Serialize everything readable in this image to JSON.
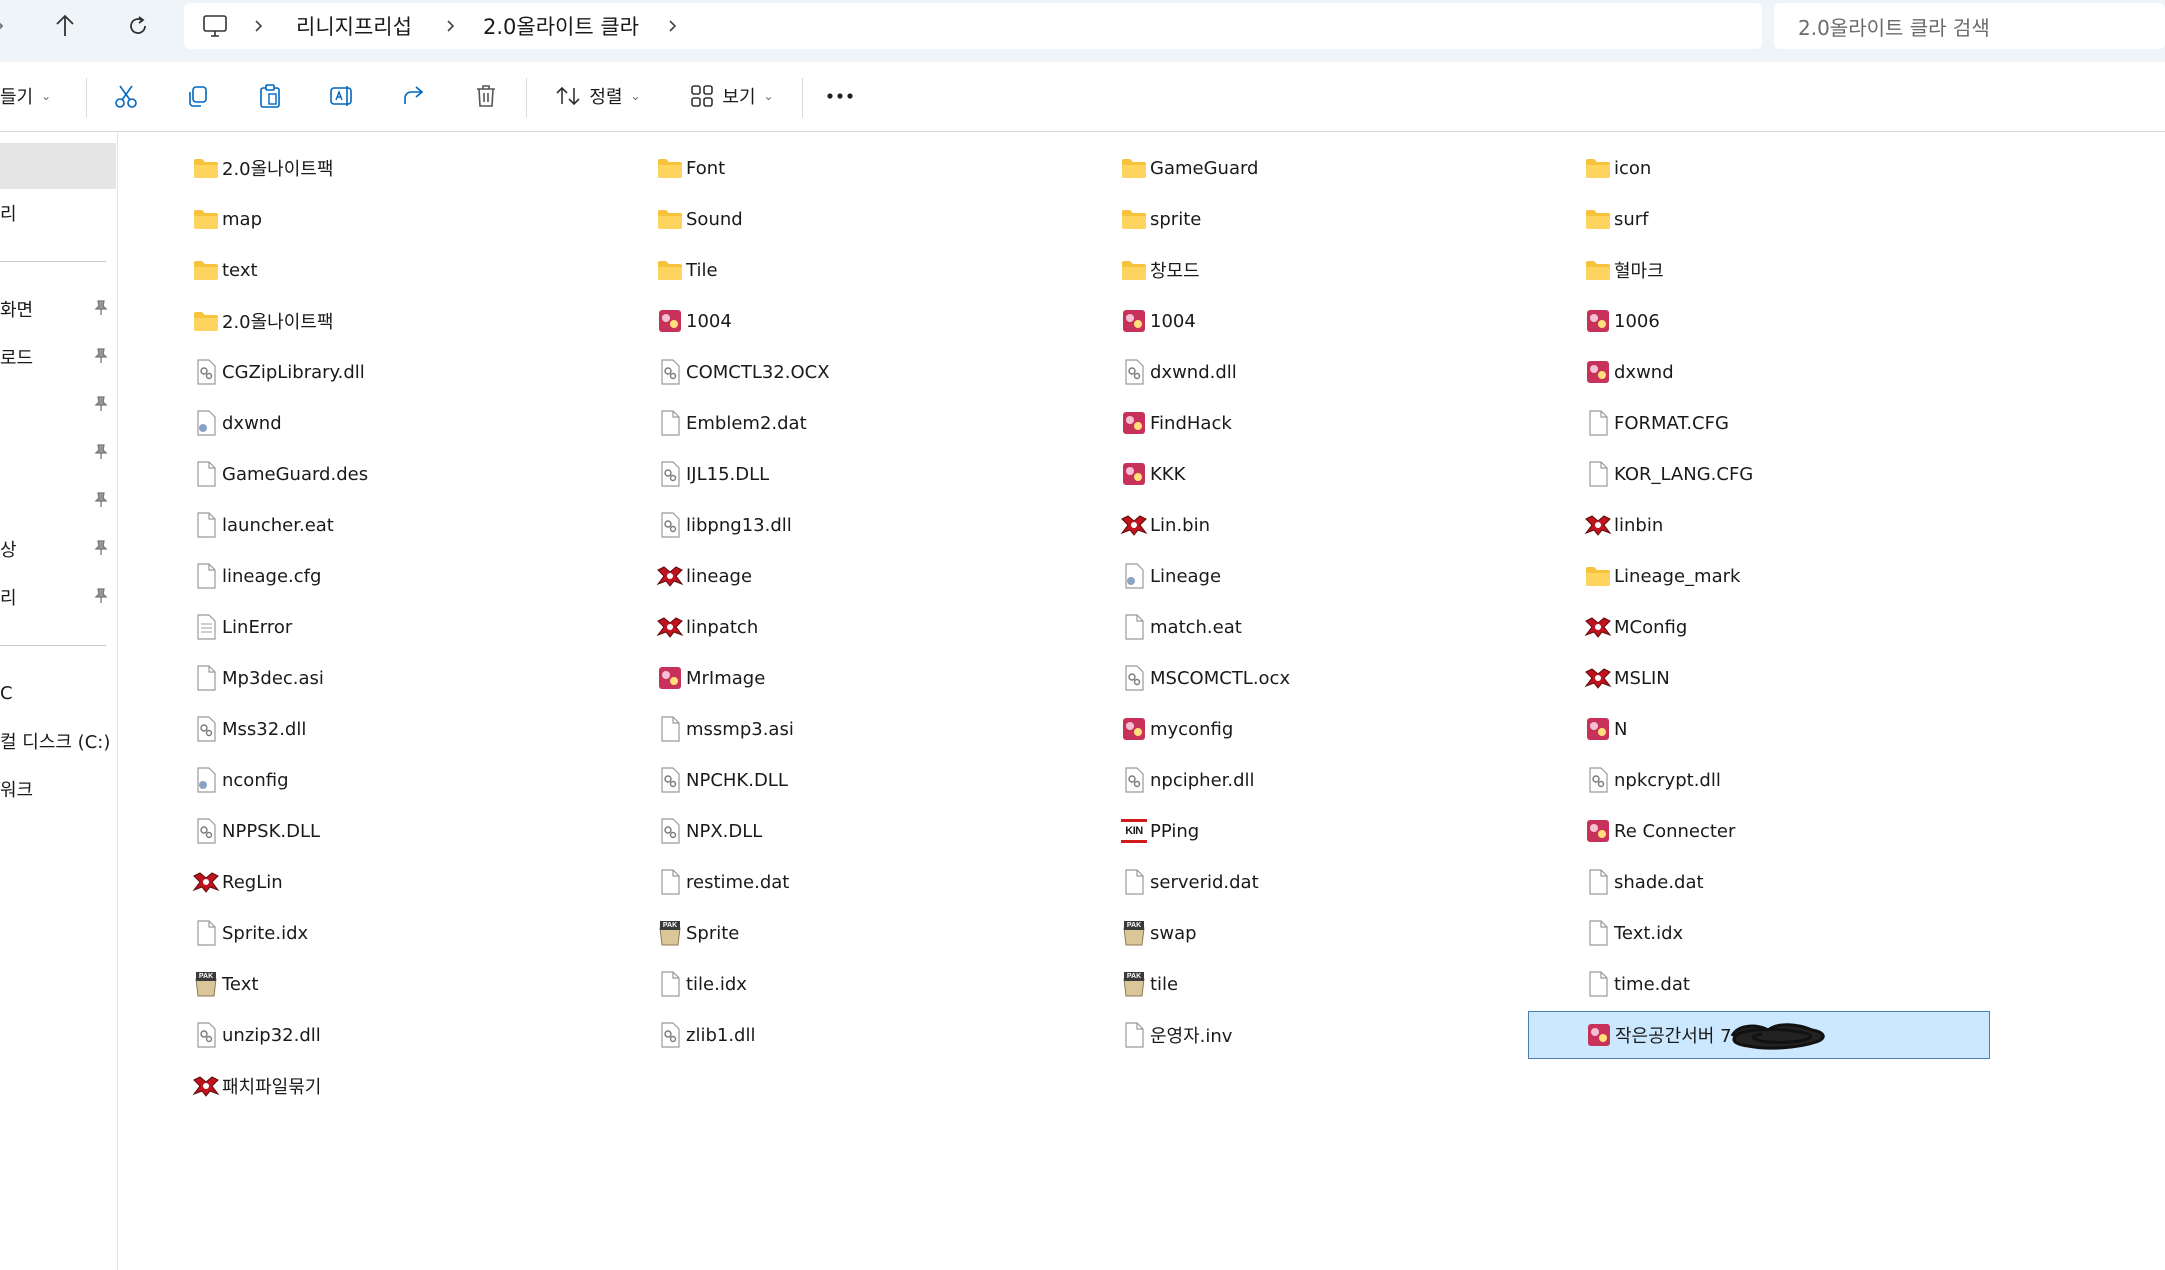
{
  "breadcrumb": {
    "items": [
      "리니지프리섭",
      "2.0올라이트 클라"
    ]
  },
  "search": {
    "placeholder": "2.0올라이트 클라 검색"
  },
  "toolbar": {
    "new_label": "들기",
    "sort_label": "정렬",
    "view_label": "보기"
  },
  "sidebar": {
    "items": [
      "리",
      "화면",
      "로드",
      "상",
      "리",
      "C",
      "컬 디스크 (C:)",
      "워크"
    ]
  },
  "files": [
    [
      "2.0올나이트팩",
      "Font",
      "GameGuard",
      "icon"
    ],
    [
      "map",
      "Sound",
      "sprite",
      "surf"
    ],
    [
      "text",
      "Tile",
      "창모드",
      "혈마크"
    ],
    [
      "2.0올나이트팩",
      "1004",
      "1004",
      "1006"
    ],
    [
      "CGZipLibrary.dll",
      "COMCTL32.OCX",
      "dxwnd.dll",
      "dxwnd"
    ],
    [
      "dxwnd",
      "Emblem2.dat",
      "FindHack",
      "FORMAT.CFG"
    ],
    [
      "GameGuard.des",
      "IJL15.DLL",
      "KKK",
      "KOR_LANG.CFG"
    ],
    [
      "launcher.eat",
      "libpng13.dll",
      "Lin.bin",
      "linbin"
    ],
    [
      "lineage.cfg",
      "lineage",
      "Lineage",
      "Lineage_mark"
    ],
    [
      "LinError",
      "linpatch",
      "match.eat",
      "MConfig"
    ],
    [
      "Mp3dec.asi",
      "MrImage",
      "MSCOMCTL.ocx",
      "MSLIN"
    ],
    [
      "Mss32.dll",
      "mssmp3.asi",
      "myconfig",
      "N"
    ],
    [
      "nconfig",
      "NPCHK.DLL",
      "npcipher.dll",
      "npkcrypt.dll"
    ],
    [
      "NPPSK.DLL",
      "NPX.DLL",
      "PPing",
      "Re Connecter"
    ],
    [
      "RegLin",
      "restime.dat",
      "serverid.dat",
      "shade.dat"
    ],
    [
      "Sprite.idx",
      "Sprite",
      "swap",
      "Text.idx"
    ],
    [
      "Text",
      "tile.idx",
      "tile",
      "time.dat"
    ],
    [
      "unzip32.dll",
      "zlib1.dll",
      "운영자.inv",
      "작은공간서버                 7  2000"
    ],
    [
      "패치파일묶기"
    ]
  ],
  "icons": [
    [
      "folder-icon",
      "folder-icon",
      "folder-icon",
      "folder-icon"
    ],
    [
      "folder-icon",
      "folder-icon",
      "folder-icon",
      "folder-icon"
    ],
    [
      "folder-icon",
      "folder-icon",
      "folder-icon",
      "folder-icon"
    ],
    [
      "folder-icon",
      "app-icon",
      "app-icon",
      "app-icon"
    ],
    [
      "dll-icon",
      "dll-icon",
      "dll-icon",
      "app-icon"
    ],
    [
      "settings-file-icon",
      "file-icon",
      "app-icon",
      "file-icon"
    ],
    [
      "file-icon",
      "dll-icon",
      "app-icon",
      "file-icon"
    ],
    [
      "file-icon",
      "dll-icon",
      "lineage-icon",
      "lineage-icon"
    ],
    [
      "file-icon",
      "lineage-icon",
      "settings-file-icon",
      "folder-icon"
    ],
    [
      "text-file-icon",
      "lineage-icon",
      "file-icon",
      "lineage-icon"
    ],
    [
      "file-icon",
      "app-icon",
      "dll-icon",
      "lineage-icon"
    ],
    [
      "dll-icon",
      "file-icon",
      "app-icon",
      "app-icon"
    ],
    [
      "settings-file-icon",
      "dll-icon",
      "dll-icon",
      "dll-icon"
    ],
    [
      "dll-icon",
      "dll-icon",
      "kin-icon",
      "app-icon"
    ],
    [
      "lineage-icon",
      "file-icon",
      "file-icon",
      "file-icon"
    ],
    [
      "file-icon",
      "pak-icon",
      "pak-icon",
      "file-icon"
    ],
    [
      "pak-icon",
      "file-icon",
      "pak-icon",
      "file-icon"
    ],
    [
      "dll-icon",
      "dll-icon",
      "file-icon",
      "app-icon"
    ],
    [
      "lineage-icon"
    ]
  ],
  "colors": {
    "accent": "#0067c0",
    "selection_bg": "#cce8ff",
    "selection_border": "#4a7fb0",
    "folder": "#f8c33c",
    "topbar_bg": "#eff4f9"
  }
}
